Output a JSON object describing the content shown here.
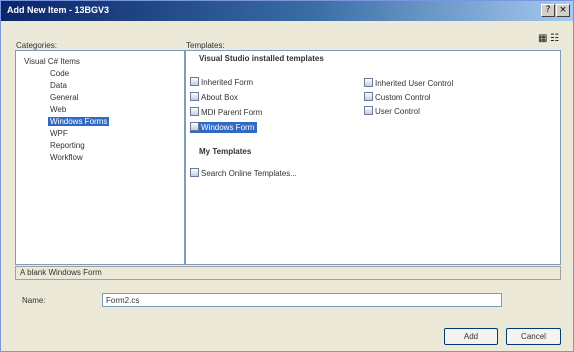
{
  "window": {
    "title": "Add New Item - 13BGV3",
    "help_glyph": "?",
    "close_glyph": "×"
  },
  "labels": {
    "categories": "Categories:",
    "templates": "Templates:",
    "name": "Name:"
  },
  "categories": {
    "root": "Visual C# Items",
    "items": [
      "Code",
      "Data",
      "General",
      "Web",
      "Windows Forms",
      "WPF",
      "Reporting",
      "Workflow"
    ],
    "selected": "Windows Forms"
  },
  "templates": {
    "installed_heading": "Visual Studio installed templates",
    "column1": [
      "Inherited Form",
      "About Box",
      "MDI Parent Form",
      "Windows Form"
    ],
    "column2": [
      "Inherited User Control",
      "Custom Control",
      "User Control"
    ],
    "selected": "Windows Form",
    "my_heading": "My Templates",
    "my_items": [
      "Search Online Templates..."
    ]
  },
  "status": {
    "description": "A blank Windows Form"
  },
  "name_field": {
    "value": "Form2.cs"
  },
  "buttons": {
    "add": "Add",
    "cancel": "Cancel"
  },
  "colors": {
    "selection": "#316ac5",
    "titlebar": "#0a246a",
    "dialog_background": "#ece9d8"
  }
}
